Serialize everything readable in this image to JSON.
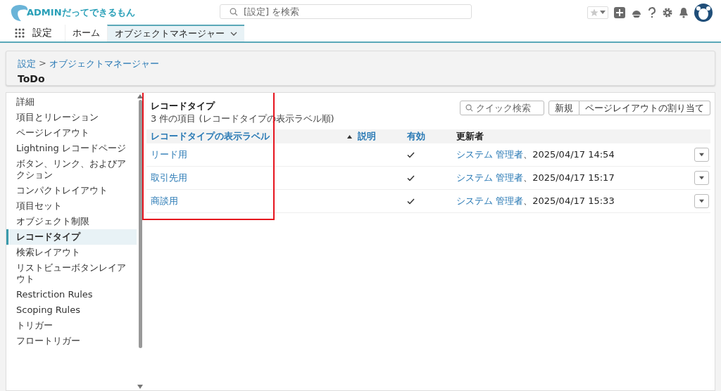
{
  "header": {
    "logo_text": "ADMINだってできるもん",
    "search": {
      "placeholder": "[設定] を検索"
    }
  },
  "nav": {
    "app_name": "設定",
    "tabs": [
      {
        "label": "ホーム",
        "selected": false
      },
      {
        "label": "オブジェクトマネージャー",
        "selected": true
      }
    ]
  },
  "page_header": {
    "breadcrumb": [
      {
        "label": "設定"
      },
      {
        "label": "オブジェクトマネージャー"
      }
    ],
    "separator": ">",
    "title": "ToDo"
  },
  "sidebar": {
    "items": [
      {
        "label": "詳細",
        "selected": false
      },
      {
        "label": "項目とリレーション",
        "selected": false
      },
      {
        "label": "ページレイアウト",
        "selected": false
      },
      {
        "label": "Lightning レコードページ",
        "selected": false
      },
      {
        "label": "ボタン、リンク、およびアクション",
        "selected": false
      },
      {
        "label": "コンパクトレイアウト",
        "selected": false
      },
      {
        "label": "項目セット",
        "selected": false
      },
      {
        "label": "オブジェクト制限",
        "selected": false
      },
      {
        "label": "レコードタイプ",
        "selected": true
      },
      {
        "label": "検索レイアウト",
        "selected": false
      },
      {
        "label": "リストビューボタンレイアウト",
        "selected": false
      },
      {
        "label": "Restriction Rules",
        "selected": false
      },
      {
        "label": "Scoping Rules",
        "selected": false
      },
      {
        "label": "トリガー",
        "selected": false
      },
      {
        "label": "フロートリガー",
        "selected": false
      }
    ]
  },
  "content": {
    "title": "レコードタイプ",
    "subtitle": "3 件の項目 (レコードタイプの表示ラベル順)",
    "quick_search": {
      "placeholder": "クイック検索"
    },
    "buttons": [
      "新規",
      "ページレイアウトの割り当て"
    ],
    "table": {
      "columns": [
        {
          "label": "レコードタイプの表示ラベル",
          "sorted": true
        },
        {
          "label": "説明",
          "sorted": false
        },
        {
          "label": "有効",
          "sorted": false
        },
        {
          "label": "更新者",
          "sorted": false
        }
      ],
      "rows": [
        {
          "label": "リード用",
          "active": true,
          "user": "システム 管理者",
          "date": "、2025/04/17 14:54"
        },
        {
          "label": "取引先用",
          "active": true,
          "user": "システム 管理者",
          "date": "、2025/04/17 15:17"
        },
        {
          "label": "商談用",
          "active": true,
          "user": "システム 管理者",
          "date": "、2025/04/17 15:33"
        }
      ]
    }
  }
}
